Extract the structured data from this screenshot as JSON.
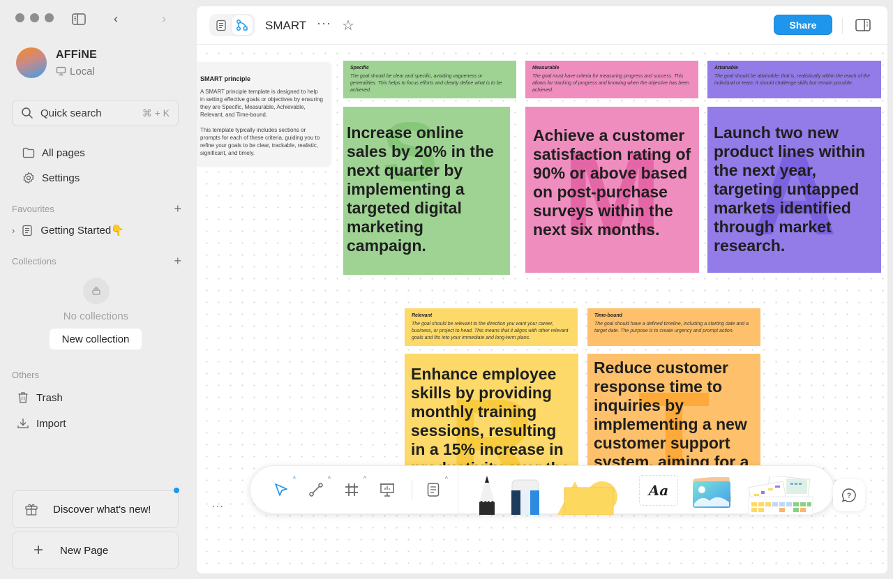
{
  "window": {
    "controls": [
      "close",
      "minimize",
      "maximize"
    ]
  },
  "sidebar": {
    "workspace": {
      "name": "AFFiNE",
      "storage": "Local"
    },
    "search": {
      "label": "Quick search",
      "shortcut": "⌘ + K"
    },
    "nav": [
      {
        "label": "All pages",
        "icon": "folder-icon"
      },
      {
        "label": "Settings",
        "icon": "gear-icon"
      }
    ],
    "favourites": {
      "title": "Favourites",
      "items": [
        {
          "label": "Getting Started👇",
          "icon": "page-icon"
        }
      ]
    },
    "collections": {
      "title": "Collections",
      "empty_text": "No collections",
      "new_button": "New collection"
    },
    "others": {
      "title": "Others",
      "items": [
        {
          "label": "Trash",
          "icon": "trash-icon"
        },
        {
          "label": "Import",
          "icon": "import-icon"
        }
      ]
    },
    "discover": {
      "label": "Discover what's new!",
      "has_badge": true
    },
    "new_page": {
      "label": "New Page"
    }
  },
  "header": {
    "title": "SMART",
    "mode": "edgeless",
    "share_label": "Share",
    "accent": "#1e96eb"
  },
  "canvas": {
    "intro": {
      "title": "SMART principle",
      "p1": "A SMART principle template is designed to help in setting effective goals or objectives by ensuring they are Specific, Measurable, Achievable, Relevant, and Time-bound.",
      "p2": "This template typically includes sections or prompts for each of these criteria, guiding you to refine your goals to be clear, trackable, realistic, significant, and timely."
    },
    "cards": [
      {
        "letter": "S",
        "title": "Specific",
        "desc": "The goal should be clear and specific, avoiding vagueness or generalities. This helps to focus efforts and clearly define what is to be achieved.",
        "goal": "Increase online sales by 20% in the next quarter by implementing a targeted digital marketing campaign.",
        "color": "#9fd394",
        "letter_color": "#86c77a"
      },
      {
        "letter": "M",
        "title": "Measurable",
        "desc": "The goal must have criteria for measuring progress and success. This allows for tracking of progress and knowing when the objective has been achieved.",
        "goal": "Achieve a customer satisfaction rating of 90% or above based on post-purchase surveys within the next six months.",
        "color": "#ef8dbf",
        "letter_color": "#e566a6"
      },
      {
        "letter": "A",
        "title": "Attainable",
        "desc": "The goal should be attainable; that is, realistically within the reach of the individual or team. It should challenge skills but remain possible.",
        "goal": "Launch two new product lines within the next year, targeting untapped markets identified through market research.",
        "color": "#937be8",
        "letter_color": "#7b62e0"
      },
      {
        "letter": "R",
        "title": "Relevant",
        "desc": "The goal should be relevant to the direction you want your career, business, or project to head. This means that it aligns with other relevant goals and fits into your immediate and long-term plans.",
        "goal": "Enhance employee skills by providing monthly training sessions, resulting in a 15% increase in productivity over the next fiscal year.",
        "color": "#fcd968",
        "letter_color": "#f8cb3e"
      },
      {
        "letter": "T",
        "title": "Time-bound",
        "desc": "The goal should have a defined timeline, including a starting date and a target date. The purpose is to create urgency and prompt action.",
        "goal": "Reduce customer response time to inquiries by implementing a new customer support system, aiming for a 30% improvement within the next three months.",
        "color": "#fec06a",
        "letter_color": "#fdaa3b"
      }
    ]
  },
  "toolbar": {
    "tools": [
      "select",
      "connector",
      "frame",
      "presentation",
      "note",
      "pen",
      "eraser",
      "shape",
      "text",
      "image",
      "template"
    ],
    "active": "select",
    "text_tool_label": "Aa"
  }
}
